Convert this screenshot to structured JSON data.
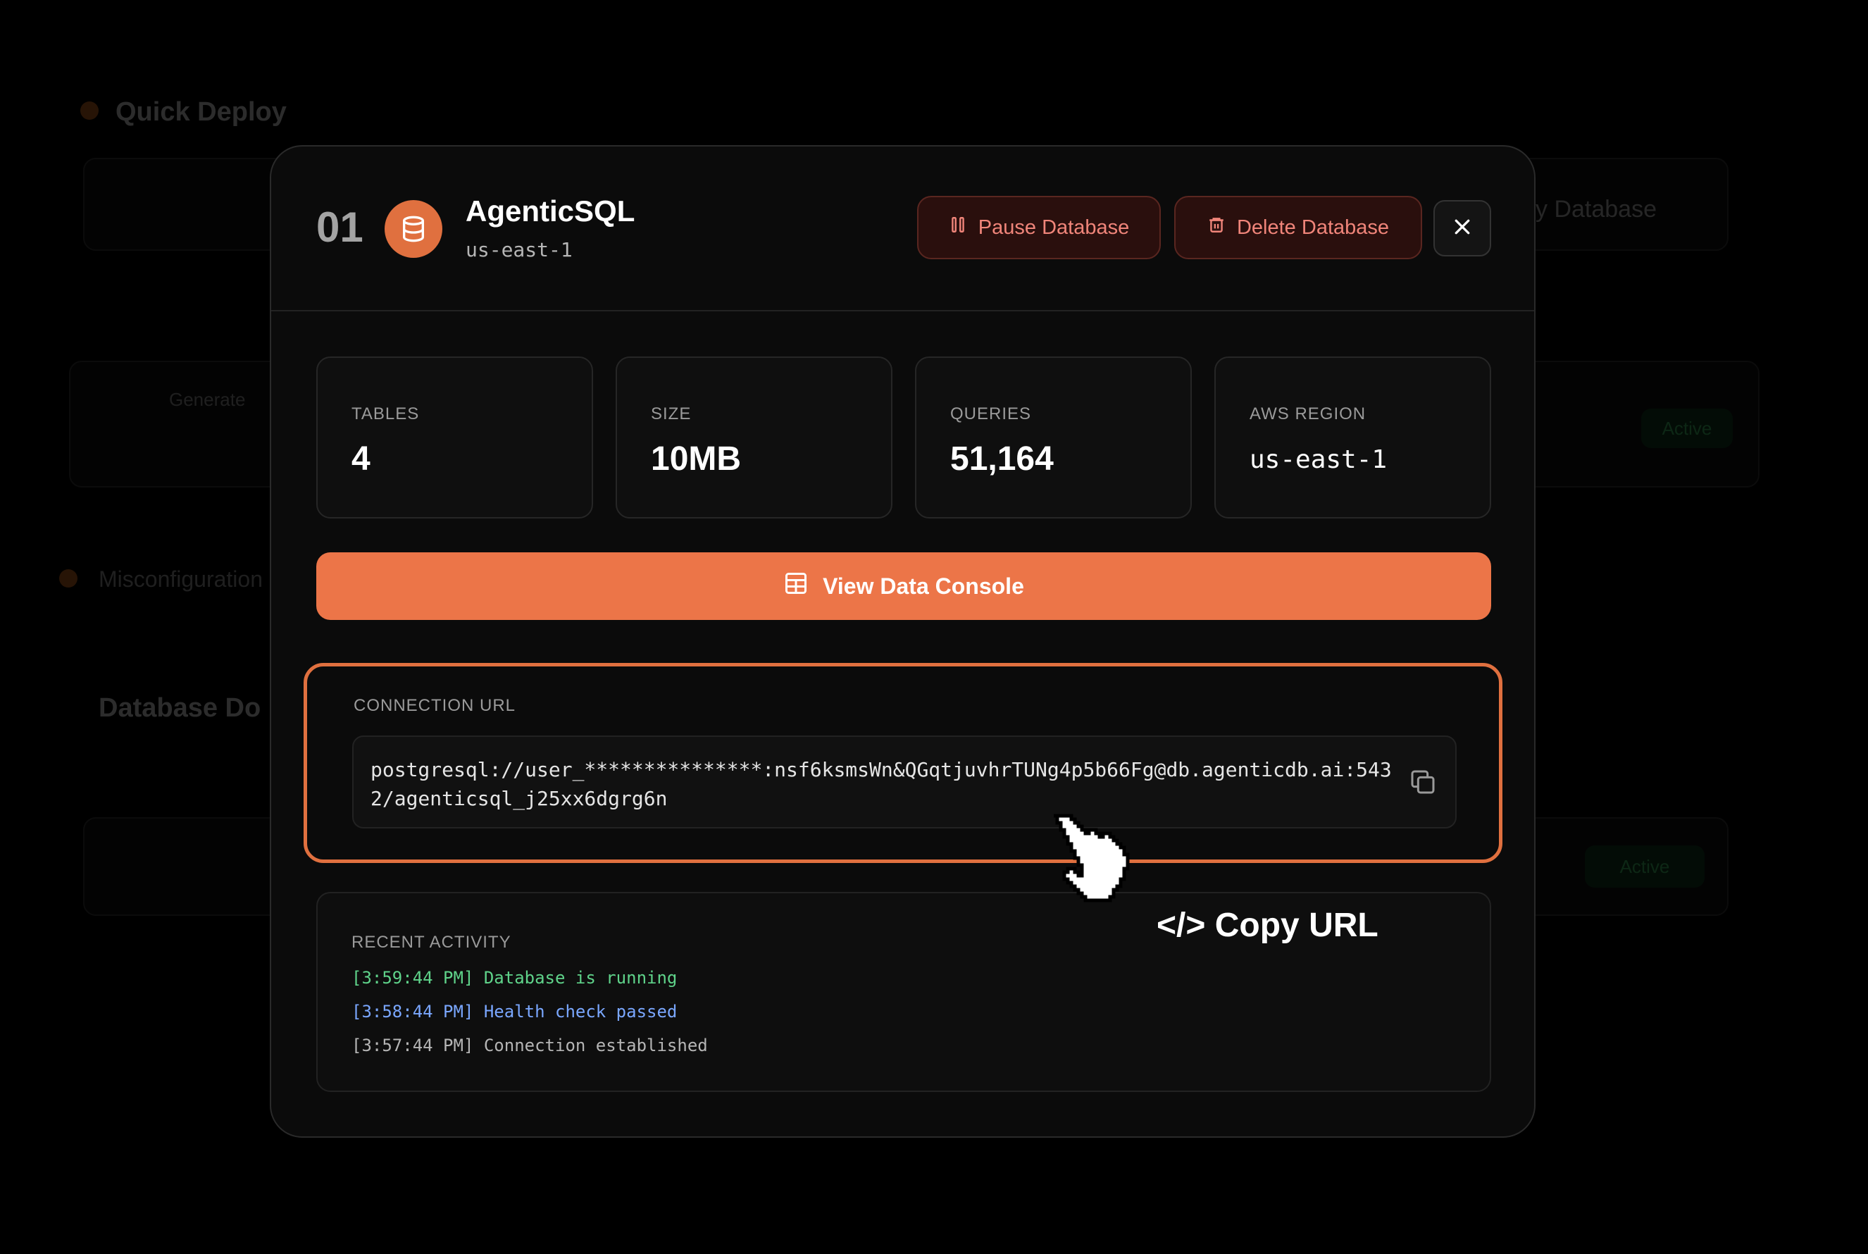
{
  "modal": {
    "index": "01",
    "db_name": "AgenticSQL",
    "db_region": "us-east-1",
    "actions": {
      "pause_label": "Pause Database",
      "delete_label": "Delete Database"
    },
    "stats": [
      {
        "label": "TABLES",
        "value": "4"
      },
      {
        "label": "SIZE",
        "value": "10MB"
      },
      {
        "label": "QUERIES",
        "value": "51,164"
      },
      {
        "label": "AWS REGION",
        "value": "us-east-1"
      }
    ],
    "console_button_label": "View Data Console",
    "connection": {
      "label": "CONNECTION URL",
      "url": "postgresql://user_***************:nsf6ksmsWn&QGqtjuvhrTUNg4p5b66Fg@db.agenticdb.ai:5432/agenticsql_j25xx6dgrg6n"
    },
    "activity": {
      "label": "RECENT ACTIVITY",
      "entries": [
        {
          "time": "[3:59:44 PM]",
          "text": "Database is running",
          "color": "#5fd38a"
        },
        {
          "time": "[3:58:44 PM]",
          "text": "Health check passed",
          "color": "#7aa7ff"
        },
        {
          "time": "[3:57:44 PM]",
          "text": "Connection established",
          "color": "#b5b5b5"
        }
      ]
    }
  },
  "overlay": {
    "cursor_label": "</> Copy URL"
  },
  "background": {
    "quick_deploy": "Quick Deploy",
    "database_label": "Generate",
    "misconfig": "Misconfiguration",
    "database_docs": "Database Do",
    "deploy_label": "y Database",
    "status": "Active"
  },
  "colors": {
    "accent": "#ec7548",
    "danger_text": "#f0857a",
    "danger_bg": "#2a0f0d",
    "modal_bg": "#0b0b0b"
  },
  "icons": {
    "db_badge": "database-icon",
    "pause": "pause-icon",
    "delete": "trash-icon",
    "close": "close-icon",
    "console": "table-grid-icon",
    "copy": "copy-icon",
    "cursor": "pointer-hand-icon"
  }
}
